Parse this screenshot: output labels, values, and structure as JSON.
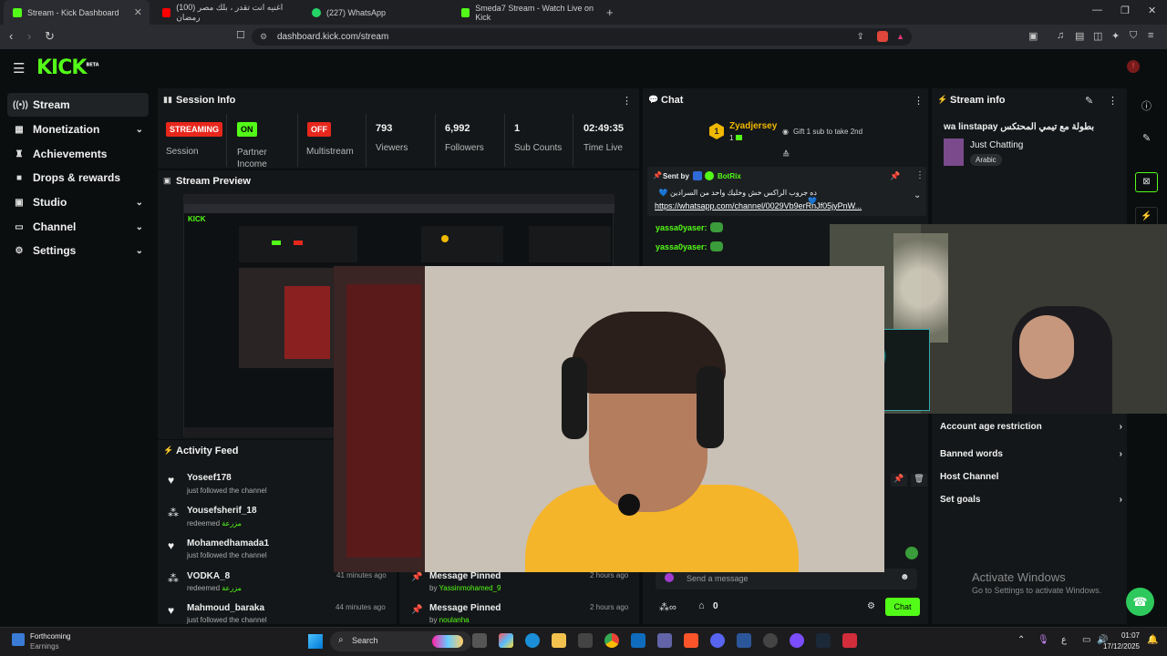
{
  "browser": {
    "tabs": [
      {
        "label": "Stream - Kick Dashboard",
        "color": "#53fc18"
      },
      {
        "label": "(100) اغنيه انت تقدر ، بلك مصر رمضان",
        "color": "#ff0000"
      },
      {
        "label": "(227) WhatsApp",
        "color": "#25d366"
      },
      {
        "label": "Smeda7 Stream - Watch Live on Kick",
        "color": "#53fc18"
      }
    ],
    "url": "dashboard.kick.com/stream"
  },
  "sidebar": {
    "items": [
      {
        "label": "Stream",
        "icon": "broadcast-icon"
      },
      {
        "label": "Monetization",
        "icon": "money-icon"
      },
      {
        "label": "Achievements",
        "icon": "trophy-icon"
      },
      {
        "label": "Drops & rewards",
        "icon": "gift-icon"
      },
      {
        "label": "Studio",
        "icon": "studio-icon"
      },
      {
        "label": "Channel",
        "icon": "channel-icon"
      },
      {
        "label": "Settings",
        "icon": "gear-icon"
      }
    ]
  },
  "session": {
    "title": "Session Info",
    "status_badge": "STREAMING",
    "status_label": "Session",
    "partner_badge": "ON",
    "partner_label": "Partner Income",
    "multistream_badge": "OFF",
    "multistream_label": "Multistream",
    "viewers_value": "793",
    "viewers_label": "Viewers",
    "followers_value": "6,992",
    "followers_label": "Followers",
    "subs_value": "1",
    "subs_label": "Sub Counts",
    "time_value": "02:49:35",
    "time_label": "Time Live"
  },
  "preview": {
    "title": "Stream Preview"
  },
  "activity": {
    "title": "Activity Feed",
    "items": [
      {
        "name": "Yoseef178",
        "sub": "just followed the channel",
        "reward": "",
        "time": ""
      },
      {
        "name": "Yousefsherif_18",
        "sub": "redeemed",
        "reward": "مزرعة",
        "time": ""
      },
      {
        "name": "Mohamedhamada1",
        "sub": "just followed the channel",
        "reward": "",
        "time": ""
      },
      {
        "name": "VODKA_8",
        "sub": "redeemed",
        "reward": "مزرعة",
        "time": "41 minutes ago"
      },
      {
        "name": "Mahmoud_baraka",
        "sub": "just followed the channel",
        "reward": "",
        "time": "44 minutes ago"
      }
    ]
  },
  "pinned": {
    "items": [
      {
        "title": "Message Pinned",
        "by": "by",
        "user": "Yassinmohamed_9",
        "time": "2 hours ago"
      },
      {
        "title": "Message Pinned",
        "by": "by",
        "user": "noulanha",
        "time": "2 hours ago"
      }
    ]
  },
  "chat": {
    "title": "Chat",
    "gifter_name": "Zyadjersey",
    "gifter_count": "1",
    "gifter_rank": "1",
    "gift_prompt": "Gift 1 sub to take 2nd",
    "pinned_sent_by": "Sent by",
    "pinned_bot": "BotRix",
    "pinned_text": "ده جروب الراكس خش وخليك واحد من السرادين 💙💙",
    "pinned_link": "https://whatsapp.com/channel/0029Vb9erRnJf05jyPnW...",
    "messages": [
      {
        "user": "yassa0yaser:",
        "text": ""
      },
      {
        "user": "yassa0yaser:",
        "text": ""
      }
    ],
    "input_placeholder": "Send a message",
    "points": "0",
    "send_label": "Chat"
  },
  "stream_info": {
    "title": "Stream info",
    "stream_title": "wa linstapay بطولة مع تيمي المحتكس",
    "category": "Just Chatting",
    "language": "Arabic",
    "menu": [
      {
        "label": "Account age restriction",
        "chevron": true
      },
      {
        "label": "Banned words",
        "chevron": true
      },
      {
        "label": "Host Channel",
        "chevron": false
      },
      {
        "label": "Set goals",
        "chevron": true
      }
    ]
  },
  "watermark": {
    "line1": "Activate Windows",
    "line2": "Go to Settings to activate Windows."
  },
  "taskbar": {
    "weather_title": "Forthcoming",
    "weather_sub": "Earnings",
    "search": "Search",
    "time": "01:07",
    "date": "17/12/2025",
    "lang": "ع"
  },
  "colors": {
    "kick_green": "#53fc18",
    "live_red": "#e8271c",
    "panel": "#141719"
  }
}
